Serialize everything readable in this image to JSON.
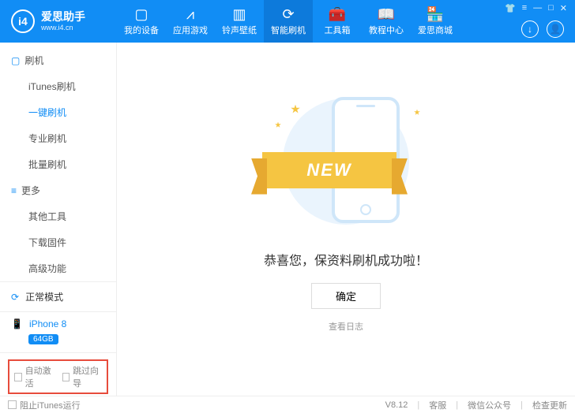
{
  "header": {
    "brand": "爱思助手",
    "url": "www.i4.cn",
    "logo_text": "i4",
    "nav": [
      {
        "label": "我的设备",
        "icon": "▢"
      },
      {
        "label": "应用游戏",
        "icon": "⩘"
      },
      {
        "label": "铃声壁纸",
        "icon": "▥"
      },
      {
        "label": "智能刷机",
        "icon": "⟳"
      },
      {
        "label": "工具箱",
        "icon": "🧰"
      },
      {
        "label": "教程中心",
        "icon": "📖"
      },
      {
        "label": "爱思商城",
        "icon": "🏪"
      }
    ],
    "download_icon": "↓",
    "user_icon": "👤"
  },
  "sidebar": {
    "group1": {
      "icon": "▢",
      "title": "刷机"
    },
    "items1": [
      {
        "label": "iTunes刷机"
      },
      {
        "label": "一键刷机"
      },
      {
        "label": "专业刷机"
      },
      {
        "label": "批量刷机"
      }
    ],
    "group2": {
      "icon": "≡",
      "title": "更多"
    },
    "items2": [
      {
        "label": "其他工具"
      },
      {
        "label": "下载固件"
      },
      {
        "label": "高级功能"
      }
    ],
    "mode": {
      "icon": "⟳",
      "label": "正常模式"
    },
    "device": {
      "icon": "📱",
      "name": "iPhone 8",
      "storage": "64GB"
    },
    "bottom": {
      "auto_activate": "自动激活",
      "skip_guide": "跳过向导"
    }
  },
  "main": {
    "new_badge": "NEW",
    "success": "恭喜您，保资料刷机成功啦！",
    "ok": "确定",
    "view_log": "查看日志"
  },
  "footer": {
    "block_itunes": "阻止iTunes运行",
    "version": "V8.12",
    "support": "客服",
    "wechat": "微信公众号",
    "update": "检查更新"
  }
}
